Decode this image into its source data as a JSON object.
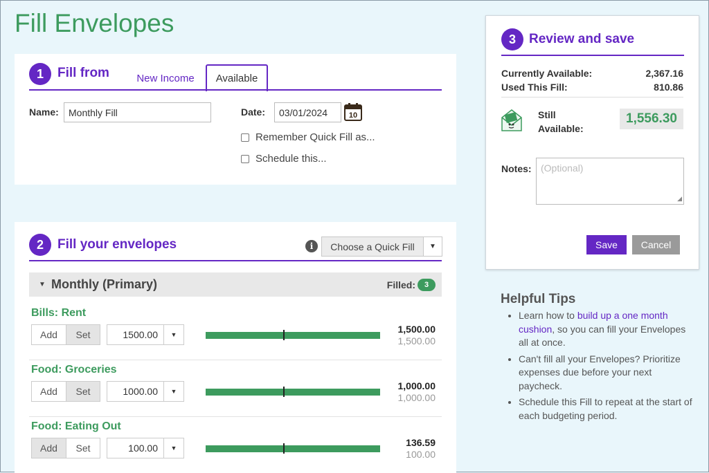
{
  "page": {
    "title": "Fill Envelopes"
  },
  "step1": {
    "number": "1",
    "title": "Fill from",
    "tabs": [
      {
        "label": "New Income",
        "active": false
      },
      {
        "label": "Available",
        "active": true
      }
    ],
    "name_label": "Name:",
    "name_value": "Monthly Fill",
    "date_label": "Date:",
    "date_value": "03/01/2024",
    "remember_label": "Remember Quick Fill as...",
    "schedule_label": "Schedule this..."
  },
  "step2": {
    "number": "2",
    "title": "Fill your envelopes",
    "info_glyph": "i",
    "quickfill_label": "Choose a Quick Fill",
    "group": {
      "name": "Monthly (Primary)",
      "filled_label": "Filled:",
      "filled_count": "3"
    },
    "envelopes": [
      {
        "name": "Bills: Rent",
        "mode": "Set",
        "amount": "1500.00",
        "current": "1,500.00",
        "budget": "1,500.00",
        "fill_fraction": 1.0
      },
      {
        "name": "Food: Groceries",
        "mode": "Set",
        "amount": "1000.00",
        "current": "1,000.00",
        "budget": "1,000.00",
        "fill_fraction": 1.0
      },
      {
        "name": "Food: Eating Out",
        "mode": "Add",
        "amount": "100.00",
        "current": "136.59",
        "budget": "100.00",
        "fill_fraction": 1.0
      }
    ],
    "add_label": "Add",
    "set_label": "Set"
  },
  "step3": {
    "number": "3",
    "title": "Review and save",
    "currently_available_label": "Currently Available:",
    "currently_available_value": "2,367.16",
    "used_this_fill_label": "Used This Fill:",
    "used_this_fill_value": "810.86",
    "still_label_1": "Still",
    "still_label_2": "Available:",
    "still_value": "1,556.30",
    "notes_label": "Notes:",
    "notes_placeholder": "(Optional)",
    "save_label": "Save",
    "cancel_label": "Cancel"
  },
  "tips": {
    "title": "Helpful Tips",
    "tip1_pre": "Learn how to ",
    "tip1_link": "build up a one month cushion",
    "tip1_post": ", so you can fill your Envelopes all at once.",
    "tip2": "Can't fill all your Envelopes? Prioritize expenses due before your next paycheck.",
    "tip3": "Schedule this Fill to repeat at the start of each budgeting period."
  },
  "colors": {
    "accent": "#6427c4",
    "green": "#3d9b5e",
    "background": "#e9f6fb"
  },
  "calendar_icon_day": "10"
}
